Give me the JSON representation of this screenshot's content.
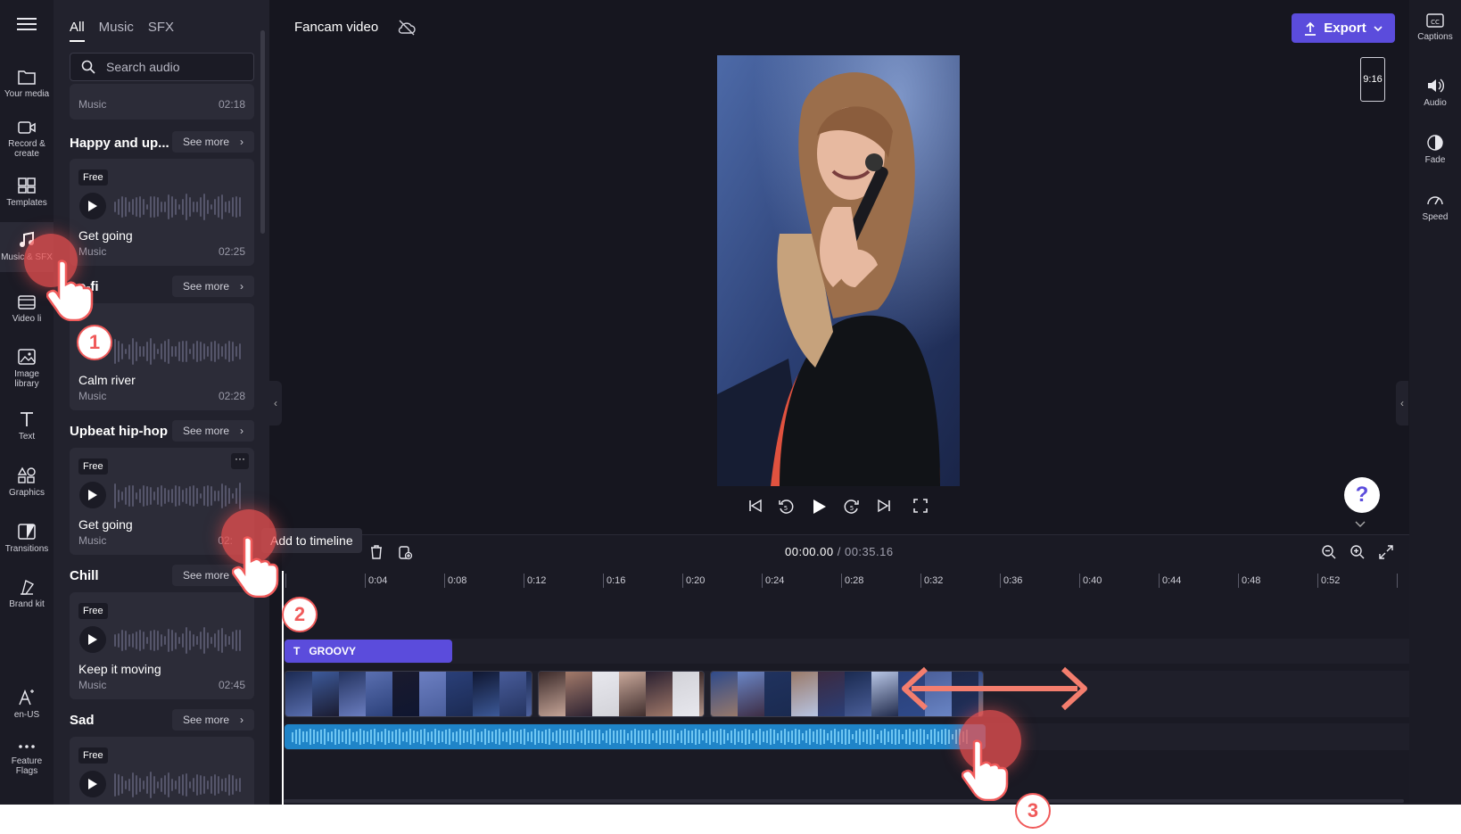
{
  "rail": {
    "items": [
      {
        "label": "Your media",
        "icon": "folder-icon"
      },
      {
        "label": "Record & create",
        "icon": "camera-icon"
      },
      {
        "label": "Templates",
        "icon": "templates-icon"
      },
      {
        "label": "Music & SFX",
        "icon": "music-icon"
      },
      {
        "label": "Video li",
        "icon": "film-icon"
      },
      {
        "label": "Image library",
        "icon": "image-icon"
      },
      {
        "label": "Text",
        "icon": "text-icon"
      },
      {
        "label": "Graphics",
        "icon": "shapes-icon"
      },
      {
        "label": "Transitions",
        "icon": "transition-icon"
      },
      {
        "label": "Brand kit",
        "icon": "brand-icon"
      },
      {
        "label": "en-US",
        "icon": "language-icon"
      },
      {
        "label": "Feature Flags",
        "icon": "more-icon"
      }
    ]
  },
  "panel": {
    "tabs": [
      "All",
      "Music",
      "SFX"
    ],
    "active_tab": "All",
    "search_placeholder": "Search audio",
    "top_partial": {
      "subtitle": "Music",
      "duration": "02:18"
    },
    "sections": [
      {
        "title": "Happy and up...",
        "see_more": "See more",
        "track": {
          "badge": "Free",
          "title": "Get going",
          "subtitle": "Music",
          "duration": "02:25"
        }
      },
      {
        "title": "Lo-fi",
        "see_more": "See more",
        "track": {
          "badge": "",
          "title": "Calm river",
          "subtitle": "Music",
          "duration": "02:28"
        }
      },
      {
        "title": "Upbeat hip-hop",
        "see_more": "See more",
        "track": {
          "badge": "Free",
          "title": "Get going",
          "subtitle": "Music",
          "duration": "02:"
        }
      },
      {
        "title": "Chill",
        "see_more": "See more",
        "track": {
          "badge": "Free",
          "title": "Keep it moving",
          "subtitle": "Music",
          "duration": "02:45"
        }
      },
      {
        "title": "Sad",
        "see_more": "See more",
        "track": {
          "badge": "Free",
          "title": "",
          "subtitle": "",
          "duration": ""
        }
      }
    ],
    "more_button": "···",
    "tooltip": "Add to timeline"
  },
  "topbar": {
    "project_name": "Fancam video",
    "export_label": "Export",
    "aspect_ratio": "9:16"
  },
  "right_rail": {
    "items": [
      {
        "label": "Captions",
        "icon": "captions-icon"
      },
      {
        "label": "Audio",
        "icon": "speaker-icon"
      },
      {
        "label": "Fade",
        "icon": "fade-icon"
      },
      {
        "label": "Speed",
        "icon": "speedometer-icon"
      }
    ]
  },
  "timeline": {
    "current_time": "00:00.00",
    "total_time": "/ 00:35.16",
    "ruler": [
      "0:04",
      "0:08",
      "0:12",
      "0:16",
      "0:20",
      "0:24",
      "0:28",
      "0:32",
      "0:36",
      "0:40",
      "0:44",
      "0:48",
      "0:52"
    ],
    "text_clip_label": "GROOVY"
  },
  "steps": [
    "1",
    "2",
    "3"
  ],
  "colors": {
    "accent": "#5b4cdc",
    "audio_clip": "#1f84c8",
    "step_red": "#f05a5a"
  }
}
